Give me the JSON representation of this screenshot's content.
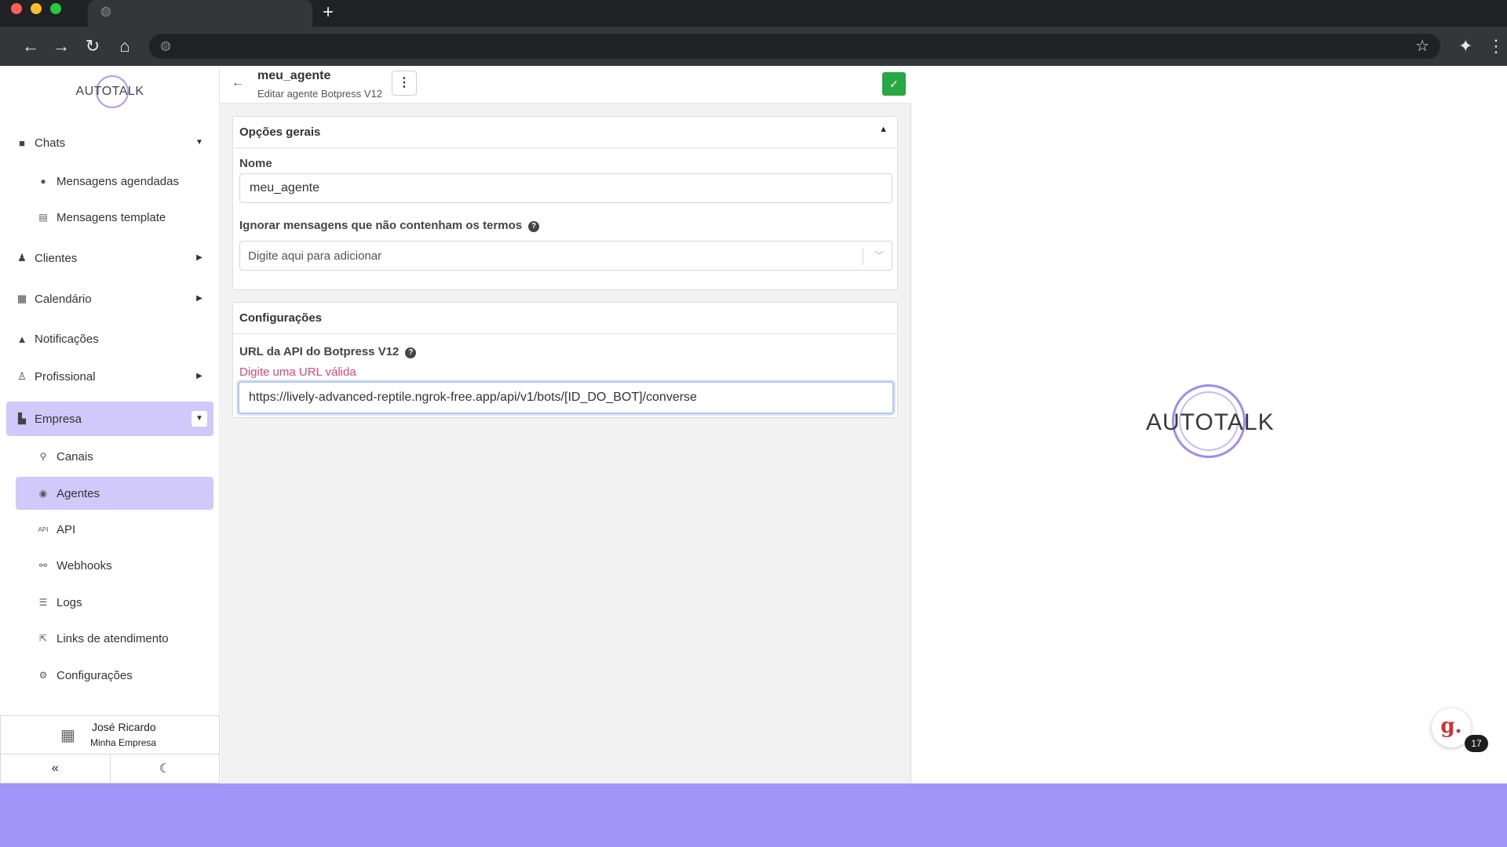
{
  "colors": {
    "accent_purple": "#a394f9",
    "active_item": "#d2c9fb",
    "success_green": "#28a745",
    "error_pink": "#e0457b"
  },
  "browser": {
    "new_tab_label": "+",
    "icons": [
      "back-icon",
      "forward-icon",
      "reload-icon",
      "home-icon",
      "globe-icon",
      "star-icon",
      "extensions-icon",
      "menu-icon"
    ]
  },
  "sidebar": {
    "logo_text": "AUTOTALK",
    "menu": [
      {
        "label": "Chats",
        "icon": "chat-icon"
      },
      {
        "label": "Mensagens agendadas",
        "icon": "clock-icon"
      },
      {
        "label": "Mensagens template",
        "icon": "template-icon"
      },
      {
        "label": "Clientes",
        "icon": "users-icon"
      },
      {
        "label": "Calendário",
        "icon": "calendar-icon"
      },
      {
        "label": "Notificações",
        "icon": "bell-icon"
      },
      {
        "label": "Profissional",
        "icon": "user-tie-icon"
      },
      {
        "label": "Empresa",
        "icon": "building-icon"
      },
      {
        "label": "Canais",
        "icon": "link-icon"
      },
      {
        "label": "Agentes",
        "icon": "robot-icon"
      },
      {
        "label": "API",
        "icon": "api-icon"
      },
      {
        "label": "Webhooks",
        "icon": "webhook-icon"
      },
      {
        "label": "Logs",
        "icon": "list-icon"
      },
      {
        "label": "Links de atendimento",
        "icon": "external-link-icon"
      },
      {
        "label": "Configurações",
        "icon": "gear-icon"
      }
    ],
    "user": {
      "name": "José Ricardo",
      "company": "Minha Empresa"
    }
  },
  "header": {
    "title": "meu_agente",
    "subtitle": "Editar agente Botpress V12"
  },
  "general": {
    "title": "Opções gerais",
    "name_label": "Nome",
    "name_value": "meu_agente",
    "ignore_label": "Ignorar mensagens que não contenham os termos",
    "ignore_placeholder": "Digite aqui para adicionar"
  },
  "config": {
    "title": "Configurações",
    "url_label": "URL da API do Botpress V12",
    "url_error": "Digite uma URL válida",
    "url_value": "https://lively-advanced-reptile.ngrok-free.app/api/v1/bots/[ID_DO_BOT]/converse"
  },
  "right": {
    "logo_text": "AUTOTALK"
  },
  "widget": {
    "letter": "g.",
    "badge": "17"
  }
}
